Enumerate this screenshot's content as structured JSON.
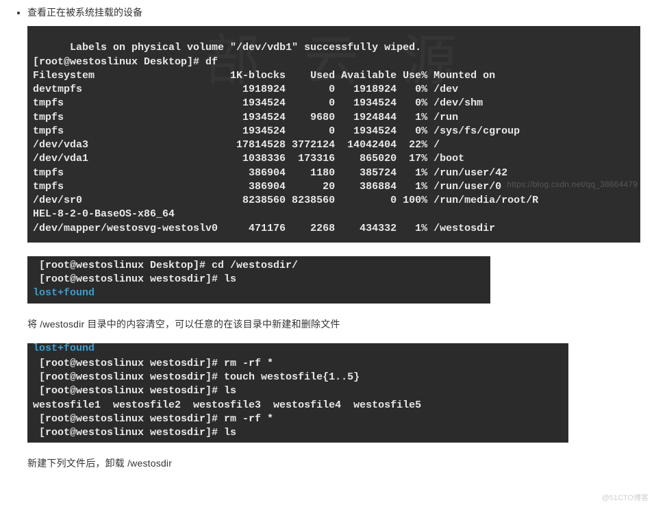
{
  "bullet": {
    "text": "查看正在被系统挂载的设备"
  },
  "term1": {
    "line0": "  Labels on physical volume \"/dev/vdb1\" successfully wiped.",
    "prompt1": "[root@westoslinux Desktop]# df",
    "header": "Filesystem                      1K-blocks    Used Available Use% Mounted on",
    "rows": [
      "devtmpfs                          1918924       0   1918924   0% /dev",
      "tmpfs                             1934524       0   1934524   0% /dev/shm",
      "tmpfs                             1934524    9680   1924844   1% /run",
      "tmpfs                             1934524       0   1934524   0% /sys/fs/cgroup",
      "/dev/vda3                        17814528 3772124  14042404  22% /",
      "/dev/vda1                         1038336  173316    865020  17% /boot",
      "tmpfs                              386904    1180    385724   1% /run/user/42",
      "tmpfs                              386904      20    386884   1% /run/user/0",
      "/dev/sr0                          8238560 8238560         0 100% /run/media/root/R",
      "HEL-8-2-0-BaseOS-x86_64",
      "/dev/mapper/westosvg-westoslv0     471176    2268    434332   1% /westosdir"
    ]
  },
  "watermark1": "https://blog.csdn.net/qq_38664479",
  "term2": {
    "line1": " [root@westoslinux Desktop]# cd /westosdir/",
    "line2": " [root@westoslinux westosdir]# ls",
    "line3": "lost+found"
  },
  "caption1": "将 /westosdir 目录中的内容清空，可以任意的在该目录中新建和删除文件",
  "term3": {
    "top": "lost+found",
    "lines": [
      " [root@westoslinux westosdir]# rm -rf *",
      " [root@westoslinux westosdir]# touch westosfile{1..5}",
      " [root@westoslinux westosdir]# ls",
      "westosfile1  westosfile2  westosfile3  westosfile4  westosfile5",
      " [root@westoslinux westosdir]# rm -rf *",
      " [root@westoslinux westosdir]# ls"
    ]
  },
  "caption2": "新建下列文件后，卸载 /westosdir",
  "footer_wm": "@51CTO博客",
  "bg_wm": "部 云 源"
}
